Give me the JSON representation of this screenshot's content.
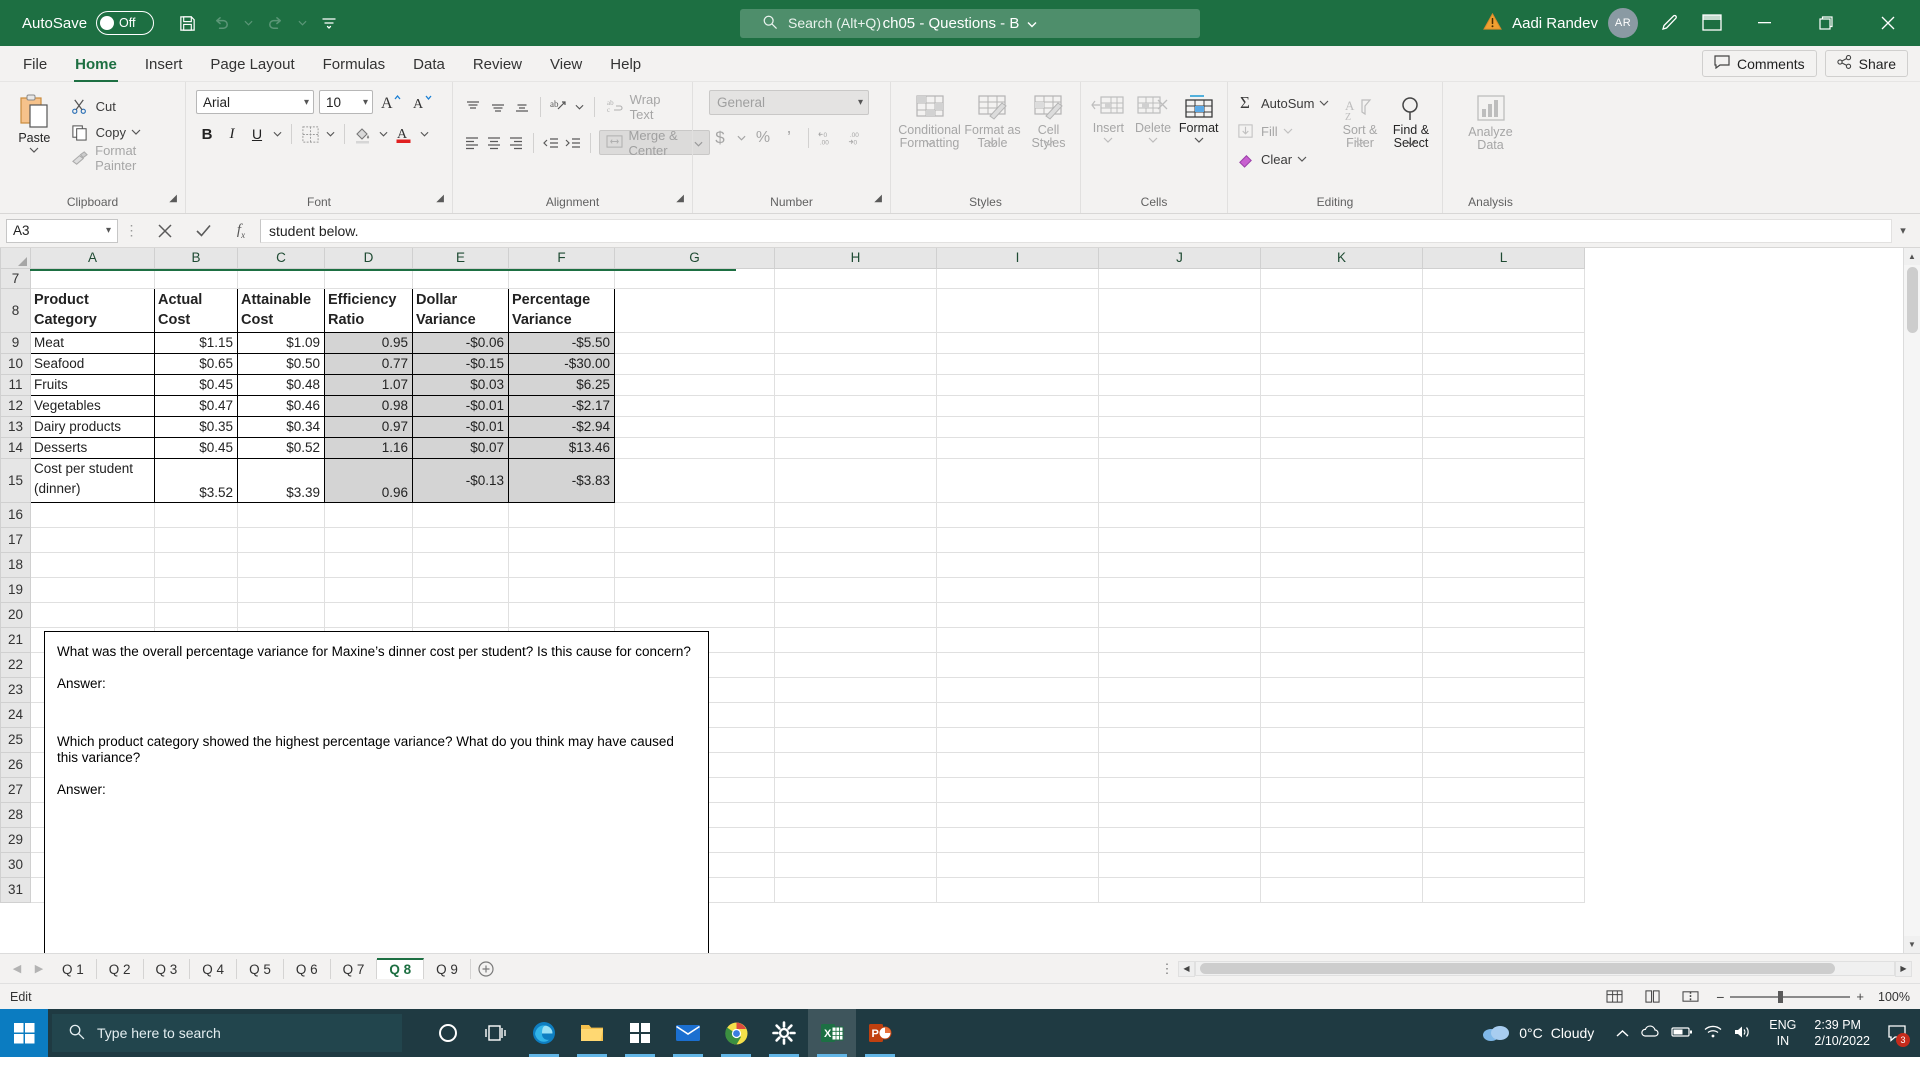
{
  "titlebar": {
    "autosave_label": "AutoSave",
    "autosave_state": "Off",
    "document_title": "ch05 - Questions - B",
    "search_placeholder": "Search (Alt+Q)",
    "account_name": "Aadi Randev",
    "account_initials": "AR",
    "icons": {
      "save": "save-icon",
      "undo": "undo-icon",
      "redo": "redo-icon",
      "customize": "customize-quick-access-icon",
      "warning": "warning-icon",
      "pen": "pen-icon",
      "ribbon_display": "ribbon-display-options-icon",
      "minimize": "minimize-icon",
      "restore": "restore-icon",
      "close": "close-icon"
    }
  },
  "ribbon_tabs": [
    {
      "label": "File",
      "active": false
    },
    {
      "label": "Home",
      "active": true
    },
    {
      "label": "Insert",
      "active": false
    },
    {
      "label": "Page Layout",
      "active": false
    },
    {
      "label": "Formulas",
      "active": false
    },
    {
      "label": "Data",
      "active": false
    },
    {
      "label": "Review",
      "active": false
    },
    {
      "label": "View",
      "active": false
    },
    {
      "label": "Help",
      "active": false
    }
  ],
  "ribbon_right": {
    "comments": "Comments",
    "share": "Share"
  },
  "ribbon": {
    "clipboard": {
      "group_label": "Clipboard",
      "paste": "Paste",
      "cut": "Cut",
      "copy": "Copy",
      "format_painter": "Format Painter"
    },
    "font": {
      "group_label": "Font",
      "font_name": "Arial",
      "font_size": "10",
      "grow_font": "A",
      "shrink_font": "A",
      "bold": "B",
      "italic": "I",
      "underline": "U"
    },
    "alignment": {
      "group_label": "Alignment",
      "wrap_text": "Wrap Text",
      "merge_center": "Merge & Center"
    },
    "number": {
      "group_label": "Number",
      "format_value": "General",
      "currency": "$",
      "percent": "%",
      "comma": ",",
      "increase_decimal": ".00",
      "decrease_decimal": ".00"
    },
    "styles": {
      "group_label": "Styles",
      "conditional_formatting": "Conditional Formatting",
      "format_as_table": "Format as Table",
      "cell_styles": "Cell Styles"
    },
    "cells": {
      "group_label": "Cells",
      "insert": "Insert",
      "delete": "Delete",
      "format": "Format"
    },
    "editing": {
      "group_label": "Editing",
      "autosum": "AutoSum",
      "fill": "Fill",
      "clear": "Clear",
      "sort_filter": "Sort & Filter",
      "find_select": "Find & Select"
    },
    "analysis": {
      "group_label": "Analysis",
      "analyze_data": "Analyze Data"
    }
  },
  "formula_bar": {
    "name_box": "A3",
    "cancel_icon": "cancel-icon",
    "enter_icon": "enter-icon",
    "function_icon": "insert-function-icon",
    "value": "student below."
  },
  "grid": {
    "columns": [
      "A",
      "B",
      "C",
      "D",
      "E",
      "F",
      "G",
      "H",
      "I",
      "J",
      "K",
      "L"
    ],
    "rows": [
      7,
      8,
      9,
      10,
      11,
      12,
      13,
      14,
      15,
      16,
      17,
      18,
      19,
      20,
      21,
      22,
      23,
      24,
      25,
      26,
      27,
      28,
      29,
      30,
      31
    ],
    "table": {
      "headers": [
        "Product Category",
        "Actual Cost",
        "Attainable Cost",
        "Efficiency Ratio",
        "Dollar Variance",
        "Percentage Variance"
      ],
      "rows": [
        {
          "row": 9,
          "category": "Meat",
          "actual": "$1.15",
          "attainable": "$1.09",
          "ratio": "0.95",
          "dollar": "-$0.06",
          "percent": "-$5.50"
        },
        {
          "row": 10,
          "category": "Seafood",
          "actual": "$0.65",
          "attainable": "$0.50",
          "ratio": "0.77",
          "dollar": "-$0.15",
          "percent": "-$30.00"
        },
        {
          "row": 11,
          "category": "Fruits",
          "actual": "$0.45",
          "attainable": "$0.48",
          "ratio": "1.07",
          "dollar": "$0.03",
          "percent": "$6.25"
        },
        {
          "row": 12,
          "category": "Vegetables",
          "actual": "$0.47",
          "attainable": "$0.46",
          "ratio": "0.98",
          "dollar": "-$0.01",
          "percent": "-$2.17"
        },
        {
          "row": 13,
          "category": "Dairy products",
          "actual": "$0.35",
          "attainable": "$0.34",
          "ratio": "0.97",
          "dollar": "-$0.01",
          "percent": "-$2.94"
        },
        {
          "row": 14,
          "category": "Desserts",
          "actual": "$0.45",
          "attainable": "$0.52",
          "ratio": "1.16",
          "dollar": "$0.07",
          "percent": "$13.46"
        },
        {
          "row": 15,
          "category": "Cost per student (dinner)",
          "actual": "$3.52",
          "attainable": "$3.39",
          "ratio": "0.96",
          "dollar": "-$0.13",
          "percent": "-$3.83"
        }
      ]
    },
    "textbox": {
      "q1": "What was the overall percentage variance for Maxine’s dinner cost per student? Is this cause for concern?",
      "a1": "Answer:",
      "q2": "Which product category showed the highest percentage variance? What do you think may have caused this variance?",
      "a2": "Answer:"
    }
  },
  "sheet_tabs": {
    "tabs": [
      "Q 1",
      "Q 2",
      "Q 3",
      "Q 4",
      "Q 5",
      "Q 6",
      "Q 7",
      "Q 8",
      "Q 9"
    ],
    "active": "Q 8",
    "add_label": "+"
  },
  "status_bar": {
    "mode": "Edit",
    "zoom": "100%",
    "views": [
      "normal-view-icon",
      "page-layout-view-icon",
      "page-break-view-icon"
    ]
  },
  "taskbar": {
    "search_placeholder": "Type here to search",
    "weather_temp": "0°C",
    "weather_desc": "Cloudy",
    "language": "ENG",
    "region": "IN",
    "time": "2:39 PM",
    "date": "2/10/2022",
    "notification_count": "3",
    "apps": [
      "cortana-icon",
      "task-view-icon",
      "edge-icon",
      "file-explorer-icon",
      "store-icon",
      "mail-icon",
      "chrome-icon",
      "settings-icon",
      "excel-icon",
      "powerpoint-icon"
    ]
  },
  "colors": {
    "excel_green": "#1d6f42",
    "ribbon_bg": "#f3f2f1",
    "shade_gray": "#d4d4d4",
    "taskbar": "#1f3a42"
  }
}
